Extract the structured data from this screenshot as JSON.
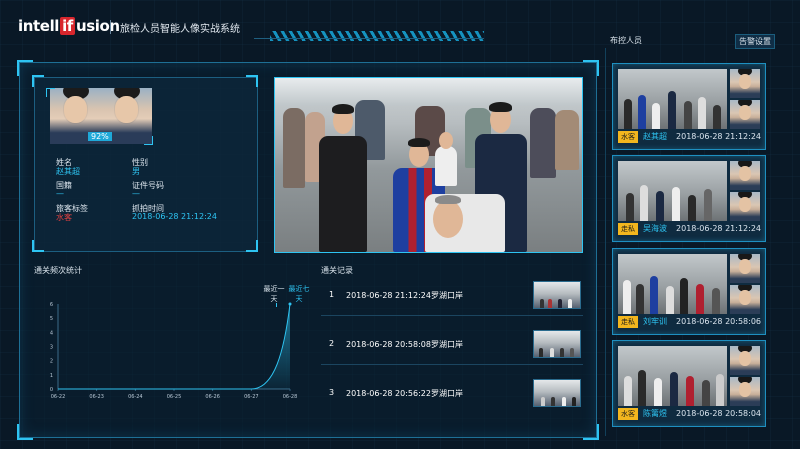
{
  "header": {
    "logo_left": "intell",
    "logo_if": "if",
    "logo_right": "usion",
    "title": "旅检人员智能人像实战系统"
  },
  "profile": {
    "match_score": "92%",
    "fields": [
      {
        "label": "姓名",
        "value": "赵其超"
      },
      {
        "label": "性别",
        "value": "男"
      },
      {
        "label": "国籍",
        "value": "—"
      },
      {
        "label": "证件号码",
        "value": "—"
      },
      {
        "label": "旅客标签",
        "value": "水客"
      },
      {
        "label": "抓拍时间",
        "value": "2018-06-28 21:12:24"
      }
    ]
  },
  "chart_section": {
    "title": "通关频次统计",
    "legend": [
      "最近一天",
      "最近七天"
    ]
  },
  "chart_data": {
    "type": "area",
    "title": "通关频次统计",
    "categories": [
      "06-22",
      "06-23",
      "06-24",
      "06-25",
      "06-26",
      "06-27",
      "06-28"
    ],
    "series": [
      {
        "name": "最近七天",
        "values": [
          0,
          0,
          0,
          0,
          0,
          0,
          6
        ]
      }
    ],
    "y_ticks": [
      0,
      1,
      2,
      3,
      4,
      5,
      6
    ],
    "ylim": [
      0,
      6
    ],
    "accent": "#2ec4f2"
  },
  "records": {
    "title": "通关记录",
    "rows": [
      {
        "index": "1",
        "text": "2018-06-28 21:12:24罗湖口岸"
      },
      {
        "index": "2",
        "text": "2018-06-28 20:58:08罗湖口岸"
      },
      {
        "index": "3",
        "text": "2018-06-28 20:56:22罗湖口岸"
      }
    ]
  },
  "sidebar": {
    "title": "布控人员",
    "settings_label": "告警设置",
    "cards": [
      {
        "tag": "水客",
        "name": "赵其超",
        "time": "2018-06-28 21:12:24"
      },
      {
        "tag": "走私",
        "name": "吴海波",
        "time": "2018-06-28 21:12:24"
      },
      {
        "tag": "走私",
        "name": "刘牢训",
        "time": "2018-06-28 20:58:06"
      },
      {
        "tag": "水客",
        "name": "陈篱煜",
        "time": "2018-06-28 20:58:04"
      }
    ]
  },
  "colors": {
    "accent": "#2ec4f2",
    "tag": "#f2b61e",
    "alert_text": "#e04040",
    "background": "#091826"
  }
}
